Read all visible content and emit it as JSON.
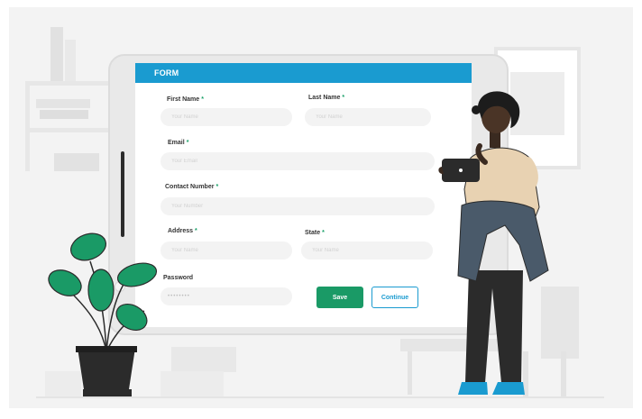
{
  "form": {
    "title": "FORM",
    "fields": {
      "first_name": {
        "label": "First Name",
        "placeholder": "Your Name"
      },
      "last_name": {
        "label": "Last Name",
        "placeholder": "Your Name"
      },
      "email": {
        "label": "Email",
        "placeholder": "Your Email"
      },
      "contact_number": {
        "label": "Contact Number",
        "placeholder": "Your Number"
      },
      "address": {
        "label": "Address",
        "placeholder": "Your Name"
      },
      "state": {
        "label": "State",
        "placeholder": "Your Name"
      },
      "password": {
        "label": "Password",
        "value": "••••••••"
      }
    },
    "required_marker": "*",
    "buttons": {
      "save": "Save",
      "continue": "Continue"
    }
  },
  "colors": {
    "header": "#1a9bd0",
    "save": "#1a9a66",
    "continue_text": "#1a9bd0",
    "plant": "#1a9a66",
    "shoes": "#1a9bd0"
  },
  "icons": [
    "tablet-device",
    "potted-plant",
    "person-holding-tablet",
    "wall-frame",
    "bookshelf"
  ]
}
